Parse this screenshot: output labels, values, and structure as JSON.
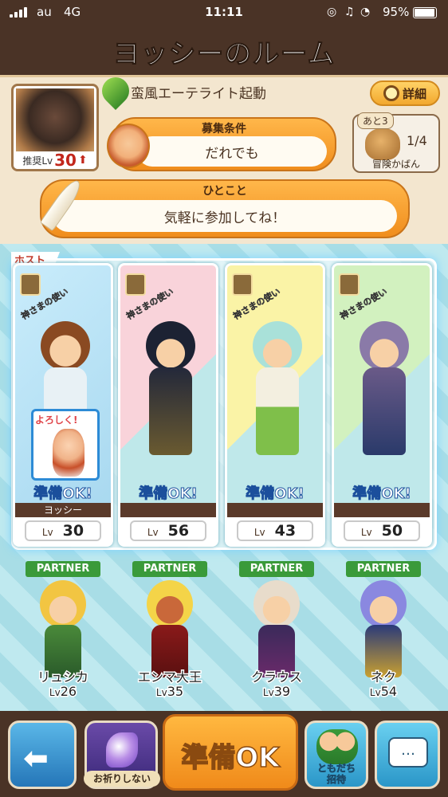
{
  "status_bar": {
    "carrier": "au",
    "network": "4G",
    "time": "11:11",
    "battery": "95%"
  },
  "header": {
    "title": "ヨッシーのルーム"
  },
  "quest": {
    "name": "蛮風エーテライト起動",
    "recommended_label": "推奨Lv",
    "recommended_level": "30",
    "detail_label": "詳細"
  },
  "recruit": {
    "label": "募集条件",
    "value": "だれでも"
  },
  "bag": {
    "badge": "あと3",
    "count": "1/4",
    "label": "冒険かばん"
  },
  "comment": {
    "label": "ひとこと",
    "value": "気軽に参加してね！"
  },
  "party": {
    "host_label": "ホスト",
    "role_label": "神さまの使い",
    "ready_label": "準備OK!",
    "lv_label": "Lv",
    "sticker_text": "よろしく!",
    "members": [
      {
        "name": "ヨッシー",
        "level": "30",
        "role_icon": "bow-icon",
        "bg": "#bfe3f5"
      },
      {
        "name": "",
        "level": "56",
        "role_icon": "shield-icon",
        "bg": "#f6c6cf"
      },
      {
        "name": "",
        "level": "43",
        "role_icon": "bow-icon",
        "bg": "#f8ef9a"
      },
      {
        "name": "",
        "level": "50",
        "role_icon": "staff-icon",
        "bg": "#c6ecb2"
      }
    ],
    "partner_tag": "PARTNER",
    "partners": [
      {
        "name": "リュシカ",
        "level": "26"
      },
      {
        "name": "エンマ大王",
        "level": "35"
      },
      {
        "name": "クラウス",
        "level": "39"
      },
      {
        "name": "ネク",
        "level": "54"
      }
    ]
  },
  "bottom": {
    "pray_label": "お祈りしない",
    "ready_label": "準備OK",
    "friend_label_1": "ともだち",
    "friend_label_2": "招待"
  }
}
